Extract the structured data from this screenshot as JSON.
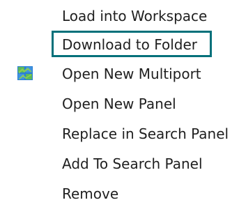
{
  "context_menu": {
    "items": [
      {
        "label": "Load into Workspace",
        "icon": null,
        "focused": false
      },
      {
        "label": "Download to Folder",
        "icon": null,
        "focused": true
      },
      {
        "label": "Open New Multiport",
        "icon": "multiport-grid-icon",
        "focused": false
      },
      {
        "label": "Open New Panel",
        "icon": null,
        "focused": false
      },
      {
        "label": "Replace in Search Panel",
        "icon": null,
        "focused": false
      },
      {
        "label": "Add To Search Panel",
        "icon": null,
        "focused": false
      },
      {
        "label": "Remove",
        "icon": null,
        "focused": false
      }
    ],
    "focus_color": "#00707a",
    "icon_colors": {
      "green": "#4caf50",
      "blue": "#2a7fd4"
    }
  }
}
